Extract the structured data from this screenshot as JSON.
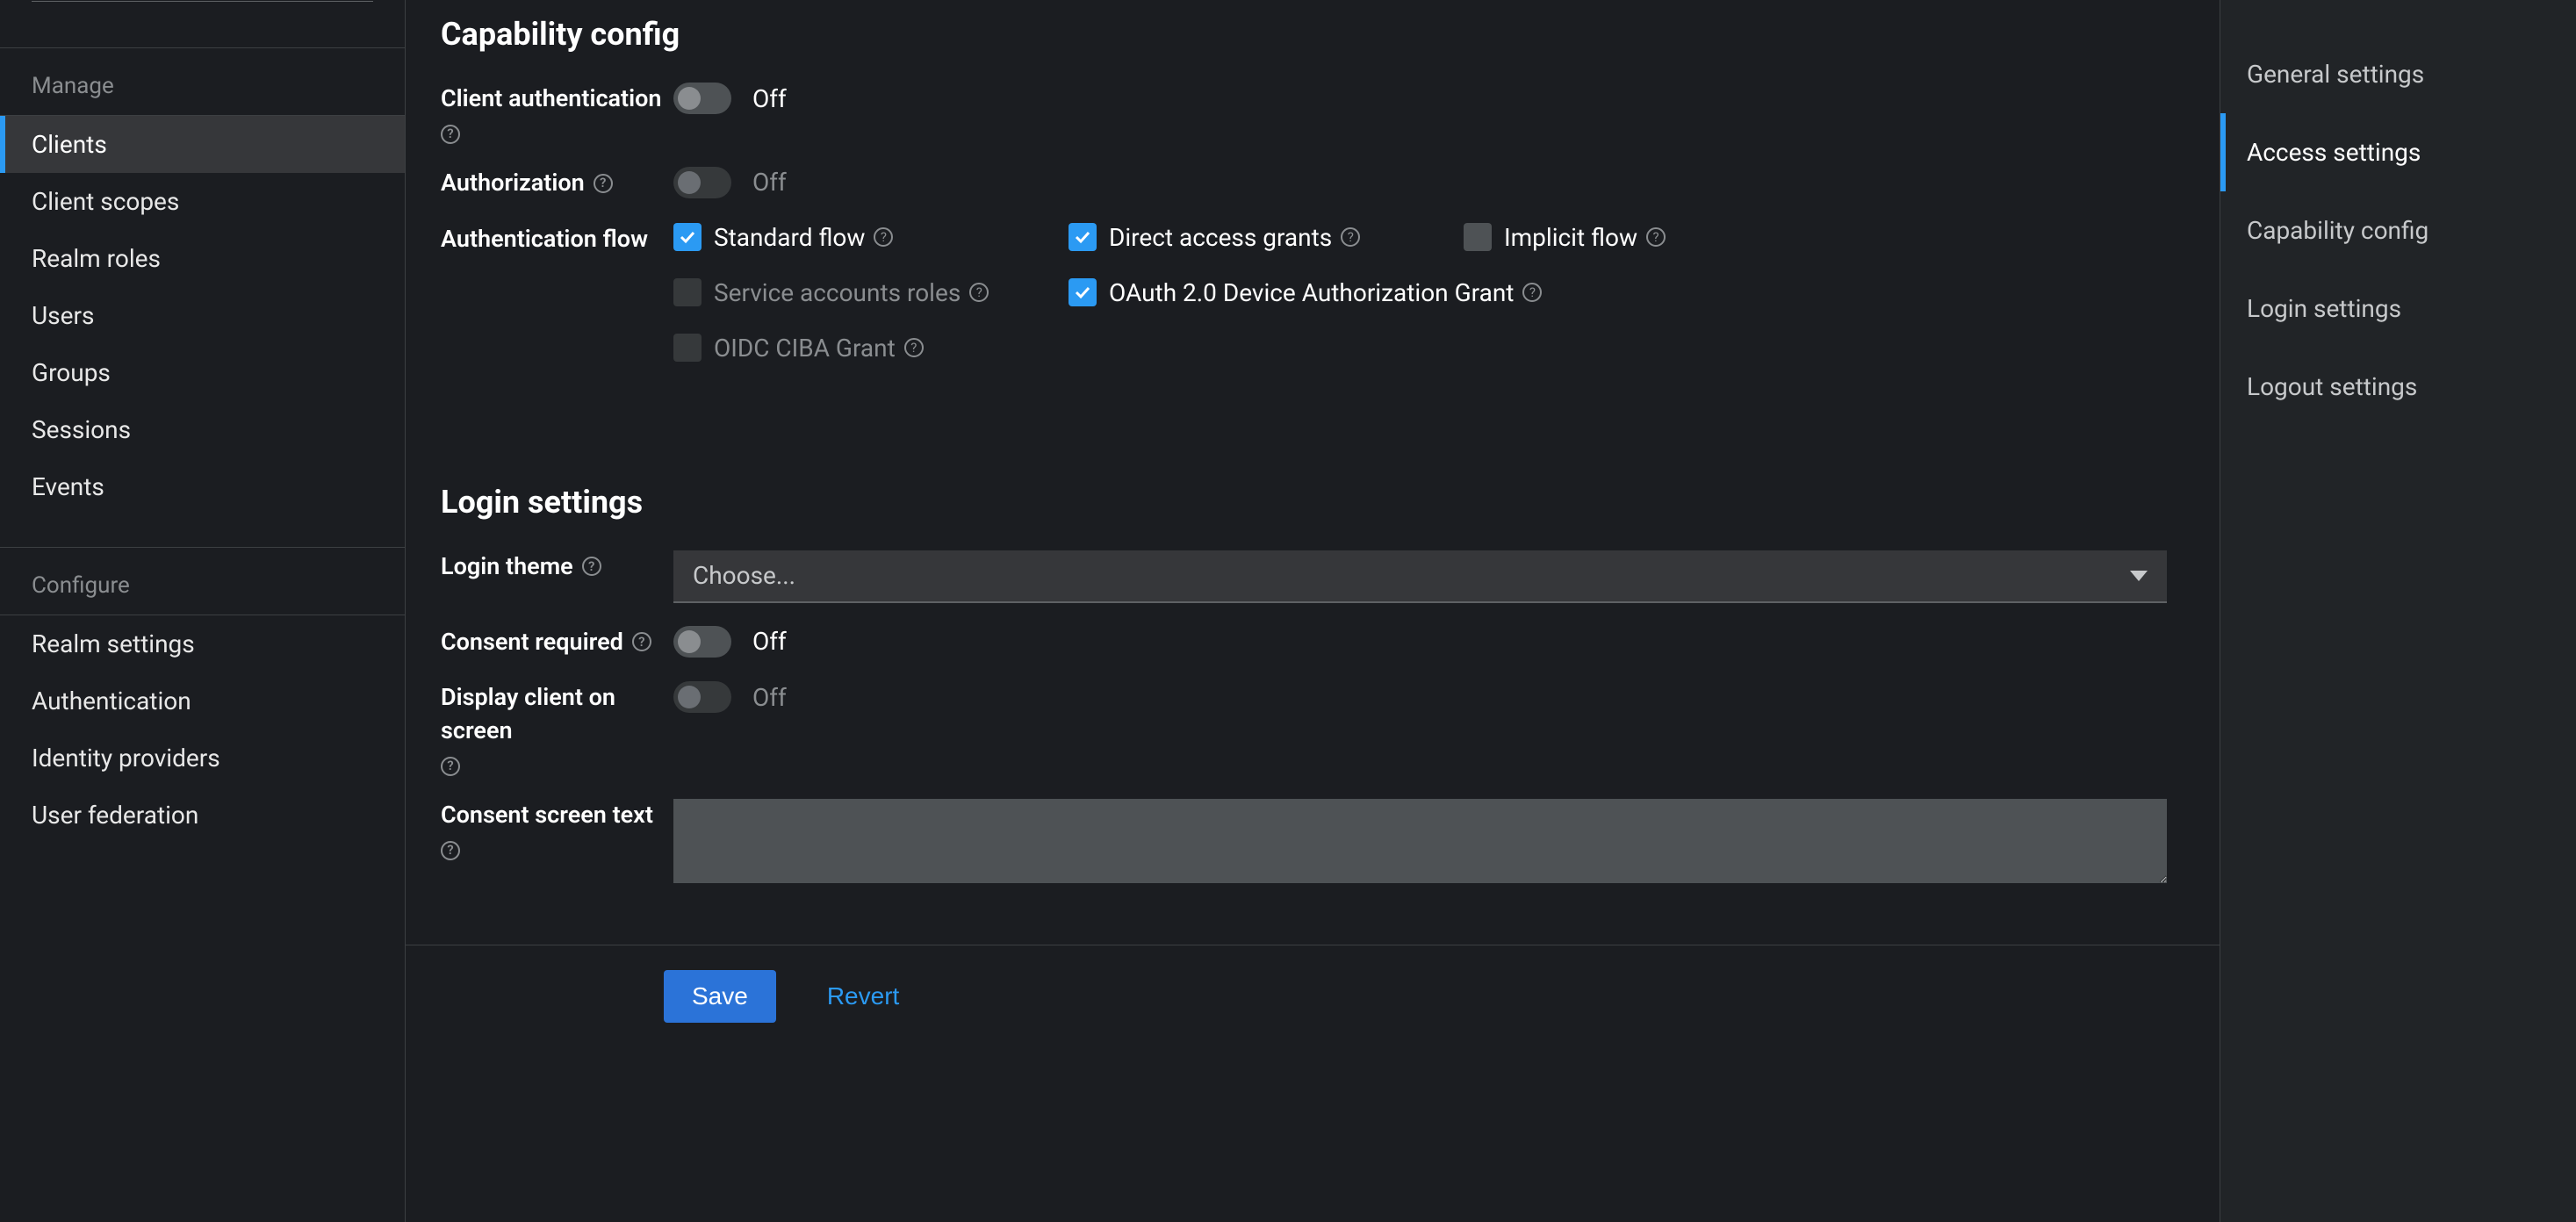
{
  "sidebar": {
    "manage_label": "Manage",
    "configure_label": "Configure",
    "items_manage": [
      {
        "label": "Clients",
        "active": true
      },
      {
        "label": "Client scopes"
      },
      {
        "label": "Realm roles"
      },
      {
        "label": "Users"
      },
      {
        "label": "Groups"
      },
      {
        "label": "Sessions"
      },
      {
        "label": "Events"
      }
    ],
    "items_configure": [
      {
        "label": "Realm settings"
      },
      {
        "label": "Authentication"
      },
      {
        "label": "Identity providers"
      },
      {
        "label": "User federation"
      }
    ]
  },
  "capability": {
    "title": "Capability config",
    "client_auth_label": "Client authentication",
    "client_auth_state": "Off",
    "authorization_label": "Authorization",
    "authorization_state": "Off",
    "auth_flow_label": "Authentication flow",
    "flows": {
      "standard": {
        "label": "Standard flow",
        "checked": true
      },
      "direct": {
        "label": "Direct access grants",
        "checked": true
      },
      "implicit": {
        "label": "Implicit flow",
        "checked": false
      },
      "service": {
        "label": "Service accounts roles",
        "checked": false,
        "disabled": true
      },
      "device": {
        "label": "OAuth 2.0 Device Authorization Grant",
        "checked": true
      },
      "ciba": {
        "label": "OIDC CIBA Grant",
        "checked": false,
        "disabled": true
      }
    }
  },
  "login": {
    "title": "Login settings",
    "theme_label": "Login theme",
    "theme_placeholder": "Choose...",
    "consent_label": "Consent required",
    "consent_state": "Off",
    "display_client_label": "Display client on screen",
    "display_client_state": "Off",
    "consent_text_label": "Consent screen text",
    "consent_text_value": ""
  },
  "actions": {
    "save": "Save",
    "revert": "Revert"
  },
  "jump_nav": [
    {
      "label": "General settings"
    },
    {
      "label": "Access settings",
      "active": true
    },
    {
      "label": "Capability config"
    },
    {
      "label": "Login settings"
    },
    {
      "label": "Logout settings"
    }
  ]
}
